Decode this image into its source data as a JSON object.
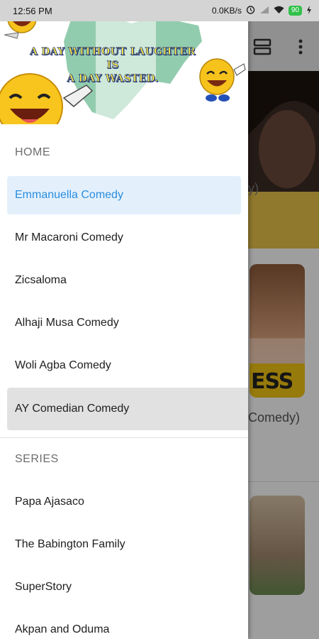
{
  "status_bar": {
    "time": "12:56 PM",
    "network_speed": "0.0KB/s",
    "battery_level": "90"
  },
  "header": {
    "banner_line1": "A DAY WITHOUT LAUGHTER IS",
    "banner_line2": "A DAY WASTED."
  },
  "background": {
    "card1_title_fragment": "y)",
    "card2_badge": "ESS",
    "card2_title_fragment": "Comedy)"
  },
  "menu": {
    "home_section": "HOME",
    "home_items": [
      {
        "label": "Emmanuella Comedy"
      },
      {
        "label": "Mr Macaroni Comedy"
      },
      {
        "label": "Zicsaloma"
      },
      {
        "label": "Alhaji Musa Comedy"
      },
      {
        "label": "Woli Agba Comedy"
      },
      {
        "label": "AY Comedian Comedy"
      }
    ],
    "series_section": "SERIES",
    "series_items": [
      {
        "label": "Papa Ajasaco"
      },
      {
        "label": "The Babington Family"
      },
      {
        "label": "SuperStory"
      },
      {
        "label": "Akpan and Oduma"
      }
    ]
  },
  "colors": {
    "accent": "#2a8de0",
    "active_bg": "#e3f0fc",
    "pressed_bg": "#e1e1e1",
    "map_green": "#86c7a5"
  },
  "icons": {
    "toolbar_layout": "view-agenda-icon",
    "toolbar_more": "more-vert-icon",
    "status_alarm": "alarm-icon",
    "status_signal": "signal-icon",
    "status_wifi": "wifi-icon",
    "status_charging": "charging-icon"
  }
}
